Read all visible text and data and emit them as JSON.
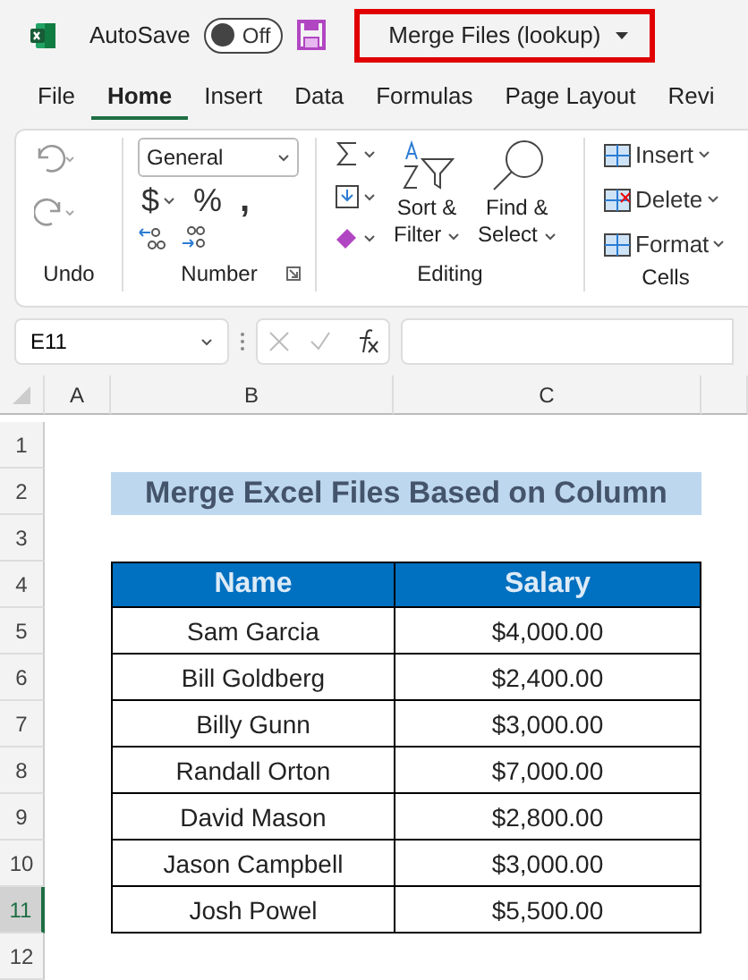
{
  "titlebar": {
    "autosave_label": "AutoSave",
    "autosave": {
      "on": false,
      "label": "Off"
    },
    "document_title": "Merge Files (lookup)"
  },
  "tabs": [
    {
      "label": "File",
      "selected": false
    },
    {
      "label": "Home",
      "selected": true
    },
    {
      "label": "Insert",
      "selected": false
    },
    {
      "label": "Data",
      "selected": false
    },
    {
      "label": "Formulas",
      "selected": false
    },
    {
      "label": "Page Layout",
      "selected": false
    },
    {
      "label": "Revi",
      "selected": false
    }
  ],
  "ribbon": {
    "undo": {
      "label": "Undo"
    },
    "number": {
      "label": "Number",
      "format": "General",
      "currency": "$",
      "percent": "%",
      "comma": ","
    },
    "editing": {
      "label": "Editing",
      "sort_filter": [
        "Sort &",
        "Filter"
      ],
      "find_select": [
        "Find &",
        "Select"
      ]
    },
    "cells": {
      "label": "Cells",
      "buttons": [
        "Insert",
        "Delete",
        "Format"
      ]
    }
  },
  "formula_bar": {
    "name_box": "E11"
  },
  "columns": [
    {
      "label": "A"
    },
    {
      "label": "B"
    },
    {
      "label": "C"
    }
  ],
  "row_numbers": [
    {
      "label": "1",
      "selected": false
    },
    {
      "label": "2",
      "selected": false
    },
    {
      "label": "3",
      "selected": false
    },
    {
      "label": "4",
      "selected": false
    },
    {
      "label": "5",
      "selected": false
    },
    {
      "label": "6",
      "selected": false
    },
    {
      "label": "7",
      "selected": false
    },
    {
      "label": "8",
      "selected": false
    },
    {
      "label": "9",
      "selected": false
    },
    {
      "label": "10",
      "selected": false
    },
    {
      "label": "11",
      "selected": true
    },
    {
      "label": "12",
      "selected": false
    }
  ],
  "sheet": {
    "title": "Merge Excel Files Based on Column",
    "table": {
      "columns": [
        "Name",
        "Salary"
      ],
      "rows": [
        [
          "Sam Garcia",
          "$4,000.00"
        ],
        [
          "Bill Goldberg",
          "$2,400.00"
        ],
        [
          "Billy Gunn",
          "$3,000.00"
        ],
        [
          "Randall Orton",
          "$7,000.00"
        ],
        [
          "David Mason",
          "$2,800.00"
        ],
        [
          "Jason Campbell",
          "$3,000.00"
        ],
        [
          "Josh Powel",
          "$5,500.00"
        ]
      ]
    }
  }
}
